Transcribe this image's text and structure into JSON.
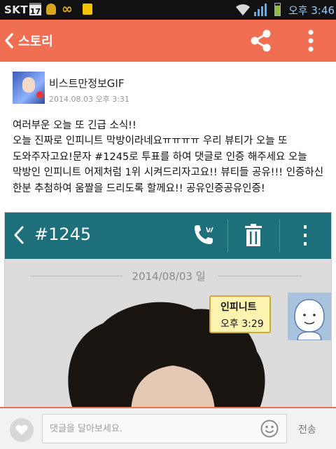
{
  "status_bar": {
    "carrier": "SKT",
    "calendar_day": "17",
    "time": "오후 3:46",
    "icons": [
      "calendar-icon",
      "notification-icon",
      "infinity-icon",
      "memo-icon",
      "wifi-icon",
      "signal-icon",
      "battery-icon"
    ]
  },
  "header": {
    "back_label": "스토리",
    "icons": [
      "back-arrow-icon",
      "share-icon",
      "more-vert-icon"
    ],
    "color": "#f06f53"
  },
  "post": {
    "author": "비스트만정보GIF",
    "timestamp": "2014.08.03 오후 3:31",
    "lines": [
      "여러부운 오늘 또 긴급 소식!!",
      "오늘 진짜로 인피니트 막방이라네요ㅠㅠㅠㅠ 우리 뷰티가 오늘 또",
      "도와주자고요!문자 #1245로 투표를 하여 댓글로 인증 해주세요 오늘",
      "막방인 인피니트 어제처럼 1위 시켜드리자고요!! 뷰티들 공유!!! 인증하신",
      "한분 추첨하여 움짤을 드리도록 할께요!! 공유인증공유인증!"
    ]
  },
  "embedded_screenshot": {
    "title": "#1245",
    "icons": [
      "back-arrow-icon",
      "call-icon",
      "trash-icon",
      "more-vert-icon"
    ],
    "date": "2014/08/03 일",
    "sender": "인피니트",
    "message_time": "오후 3:29",
    "bar_color": "#1e6f7c"
  },
  "comment_bar": {
    "placeholder": "댓글을 달아보세요.",
    "send_label": "전송",
    "icons": [
      "heart-icon",
      "emoji-icon"
    ]
  }
}
